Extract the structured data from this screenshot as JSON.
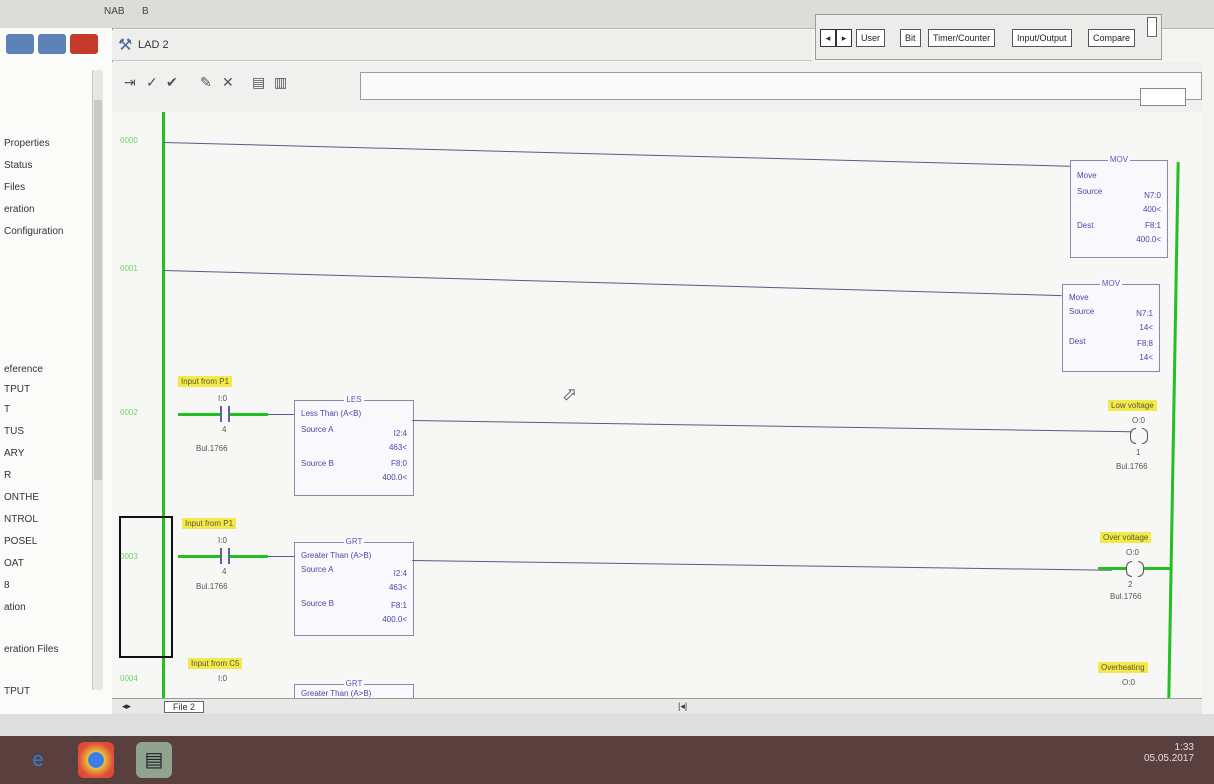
{
  "colors": {
    "rail": "#22c022",
    "tag_bg": "#f2e94a",
    "wire": "#5a5a88",
    "instr_text": "#4747a8",
    "taskbar": "#5a3f3f"
  },
  "topbar": {
    "menu": [
      "NAB",
      "B"
    ]
  },
  "tabstrip": {
    "tabs": [
      "User",
      "Bit",
      "Timer/Counter",
      "Input/Output",
      "Compare"
    ],
    "scroll_left": "◂",
    "scroll_right": "▸"
  },
  "window_controls": [
    "minimize",
    "maximize",
    "close"
  ],
  "left_tree": [
    "Properties",
    "Status",
    "Files",
    "eration",
    "Configuration",
    "",
    "eference",
    "TPUT",
    "T",
    "TUS",
    "ARY",
    "R",
    "ONTHE",
    "NTROL",
    "POSEL",
    "OAT",
    "8",
    "ation",
    "",
    "eration Files",
    "",
    "TPUT"
  ],
  "ladder": {
    "title": "LAD 2",
    "icon": "ladder-file-icon",
    "toolbar_icons": [
      "insert-rung-icon",
      "verify-icon",
      "verify-file-icon",
      "online-edit-icon",
      "cancel-edit-icon",
      "accept-icon",
      "test-icon"
    ],
    "rungs": [
      "0000",
      "0001",
      "0002",
      "0003",
      "0004"
    ],
    "mov_blocks": [
      {
        "name": "MOV",
        "title": "Move",
        "source_label": "Source",
        "source_addr": "N7:0",
        "source_val": "400<",
        "dest_label": "Dest",
        "dest_addr": "F8:1",
        "dest_val": "400.0<"
      },
      {
        "name": "MOV",
        "title": "Move",
        "source_label": "Source",
        "source_addr": "N7:1",
        "source_val": "14<",
        "dest_label": "Dest",
        "dest_addr": "F8:8",
        "dest_val": "14<"
      }
    ],
    "compare_blocks": [
      {
        "name": "LES",
        "title": "Less Than (A<B)",
        "src_a_label": "Source A",
        "src_a_addr": "I2:4",
        "src_a_val": "463<",
        "src_b_label": "Source B",
        "src_b_addr": "F8:0",
        "src_b_val": "400.0<"
      },
      {
        "name": "GRT",
        "title": "Greater Than (A>B)",
        "src_a_label": "Source A",
        "src_a_addr": "I2:4",
        "src_a_val": "463<",
        "src_b_label": "Source B",
        "src_b_addr": "F8:1",
        "src_b_val": "400.0<"
      },
      {
        "name": "GRT",
        "title": "Greater Than (A>B)"
      }
    ],
    "contacts": [
      {
        "tag": "Input from P1",
        "addr": "I:0",
        "bit": "4",
        "module": "Bul.1766"
      },
      {
        "tag": "Input from P1",
        "addr": "I:0",
        "bit": "4",
        "module": "Bul.1766"
      },
      {
        "tag": "Input from C5",
        "addr": "I:0",
        "bit": "",
        "module": ""
      }
    ],
    "coils": [
      {
        "tag": "Low voltage",
        "addr": "O:0",
        "bit": "1",
        "module": "Bul.1766"
      },
      {
        "tag": "Over voltage",
        "addr": "O:0",
        "bit": "2",
        "module": "Bul.1766"
      },
      {
        "tag": "Overheating",
        "addr": "O:0",
        "bit": "",
        "module": ""
      }
    ],
    "sheet_tab": "File 2",
    "hscroll_marker": "|◂|"
  },
  "status_text": "",
  "taskbar": {
    "icons": [
      "internet-explorer-icon",
      "chrome-icon",
      "rslogix-icon"
    ],
    "tray_time": "1:33",
    "tray_date": "05.05.2017"
  }
}
